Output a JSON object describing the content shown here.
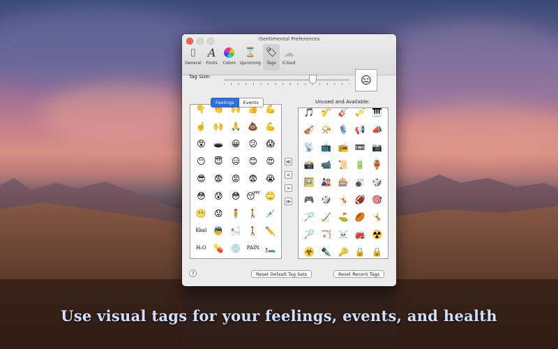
{
  "window": {
    "title": "iSentimental Preferences"
  },
  "toolbar": {
    "items": [
      {
        "label": "General",
        "icon": "general-icon",
        "glyph": "▯"
      },
      {
        "label": "Fonts",
        "icon": "fonts-icon",
        "glyph": "A"
      },
      {
        "label": "Colors",
        "icon": "colors-icon",
        "glyph": "●"
      },
      {
        "label": "Upcoming",
        "icon": "upcoming-icon",
        "glyph": "⌛"
      },
      {
        "label": "Tags",
        "icon": "tags-icon",
        "glyph": "🏷"
      },
      {
        "label": "iCloud",
        "icon": "icloud-icon",
        "glyph": "☁"
      }
    ],
    "selected": "Tags"
  },
  "tag_size": {
    "label": "Tag Size:",
    "level": 0.7,
    "preview": "😑"
  },
  "segments": {
    "feelings": "Feelings",
    "events": "Events",
    "selected": "Feelings"
  },
  "left_tags": [
    "👇",
    "👏",
    "🙌",
    "👍",
    "💪",
    "☝️",
    "🙌",
    "🙏",
    "💩",
    "💪",
    "😵",
    "🕳️",
    "😀",
    "😕",
    "😱",
    "😶",
    "😇",
    "😑",
    "😊",
    "😍",
    "😎",
    "😨",
    "😡",
    "😨",
    "😭",
    "😳",
    "😰",
    "😳",
    "😴",
    "🙄",
    "😬",
    "😟",
    "🧍",
    "🚶",
    "💉",
    "Kkal",
    "👼",
    "🛀",
    "🚶",
    "✏️",
    "H₂O",
    "💊",
    "💿",
    "PAIN",
    "🛏️"
  ],
  "unused_label": "Unused and Available:",
  "right_tags": [
    "🎵",
    "🎷",
    "🎸",
    "🎺",
    "🎹",
    "🎻",
    "📯",
    "🎙️",
    "📢",
    "📣",
    "📡",
    "📺",
    "📻",
    "📼",
    "📷",
    "📸",
    "📹",
    "📜",
    "🔋",
    "🏺",
    "🖼️",
    "🎎",
    "🎰",
    "🎳",
    "🎲",
    "🎮",
    "🎲",
    "🤸",
    "🏈",
    "🎯",
    "🏸",
    "🏑",
    "⛳",
    "🏉",
    "🤸",
    "🏸",
    "🏹",
    "☠️",
    "🚒",
    "☢️",
    "☣️",
    "✒️",
    "🔑",
    "🔒",
    "🔒"
  ],
  "arrows": [
    "≪",
    "<",
    ">",
    "≫"
  ],
  "help_label": "?",
  "buttons": {
    "reset_default": "Reset Default Tag Sets",
    "reset_recent": "Reset Recent Tags"
  },
  "caption": "Use visual tags for your feelings, events, and health"
}
